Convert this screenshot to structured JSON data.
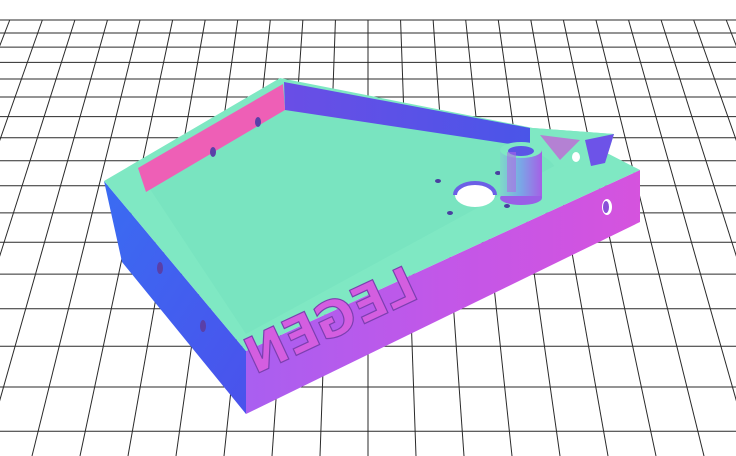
{
  "viewer": {
    "background": "#ffffff",
    "grid_color": "#2a2a2a"
  },
  "model": {
    "embossed_text": "LEGEN",
    "colors": {
      "top_face": "#7fe8c3",
      "front_face": "#c257e8",
      "left_face": "#3f66f0",
      "inner_back_wall": "#4f52e8",
      "inner_left_wall": "#ee5fb6",
      "hole": "#ffffff"
    }
  }
}
